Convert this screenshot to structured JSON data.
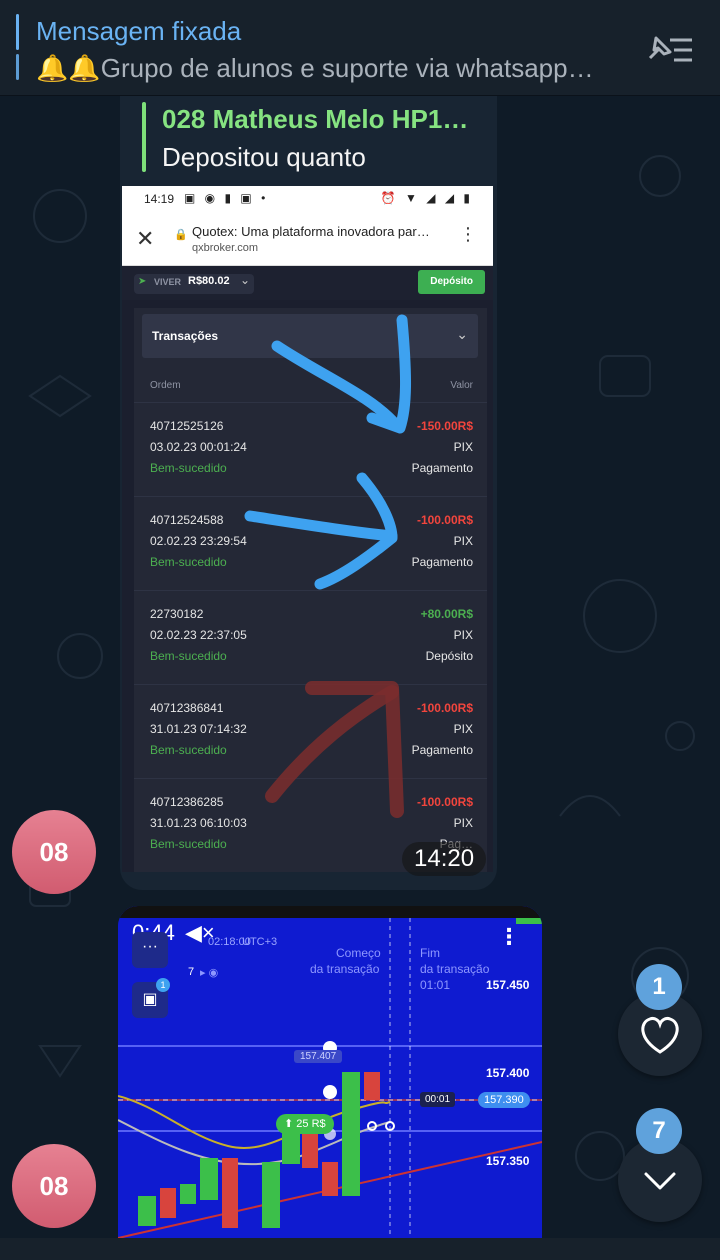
{
  "pinned": {
    "title": "Mensagem fixada",
    "text": "🔔🔔Grupo de alunos e suporte via whatsapp…"
  },
  "avatars": [
    "08",
    "08"
  ],
  "message1": {
    "reply_name": "028 Matheus Melo HP1…",
    "reply_text": "Depositou quanto",
    "time": "14:20",
    "screenshot": {
      "clock": "14:19",
      "page_title": "Quotex: Uma plataforma inovadora par…",
      "page_url": "qxbroker.com",
      "account_label": "VIVER",
      "balance": "R$80.02",
      "deposit_button": "Depósito",
      "section_title": "Transações",
      "col_order": "Ordem",
      "col_value": "Valor",
      "transactions": [
        {
          "id": "40712525126",
          "date": "03.02.23 00:01:24",
          "status": "Bem-sucedido",
          "amount": "-150.00R$",
          "method": "PIX",
          "type": "Pagamento"
        },
        {
          "id": "40712524588",
          "date": "02.02.23 23:29:54",
          "status": "Bem-sucedido",
          "amount": "-100.00R$",
          "method": "PIX",
          "type": "Pagamento"
        },
        {
          "id": "22730182",
          "date": "02.02.23 22:37:05",
          "status": "Bem-sucedido",
          "amount": "+80.00R$",
          "method": "PIX",
          "type": "Depósito"
        },
        {
          "id": "40712386841",
          "date": "31.01.23 07:14:32",
          "status": "Bem-sucedido",
          "amount": "-100.00R$",
          "method": "PIX",
          "type": "Pagamento"
        },
        {
          "id": "40712386285",
          "date": "31.01.23 06:10:03",
          "status": "Bem-sucedido",
          "amount": "-100.00R$",
          "method": "PIX",
          "type": "Pag…"
        }
      ]
    }
  },
  "message2": {
    "video_time": "0:44",
    "chart_time": "02:18:00",
    "chart_tz": "UTC+3",
    "start_label_1": "Começo",
    "start_label_2": "da transação",
    "end_label_1": "Fim",
    "end_label_2": "da transação",
    "end_time": "01:01",
    "trade_count": "7",
    "trade_badge": "1",
    "bubble_price": "157.407",
    "countdown": "00:01",
    "current_price": "157.390",
    "bet": "25 R$",
    "price_ticks": [
      "157.450",
      "157.400",
      "157.350"
    ]
  },
  "fabs": {
    "reactions_count": "1",
    "unread_count": "7"
  },
  "colors": {
    "accent": "#6ab3f3",
    "reply_green": "#86e381",
    "avatar": "#d9697c",
    "chart_bg": "#0f1bd0"
  }
}
